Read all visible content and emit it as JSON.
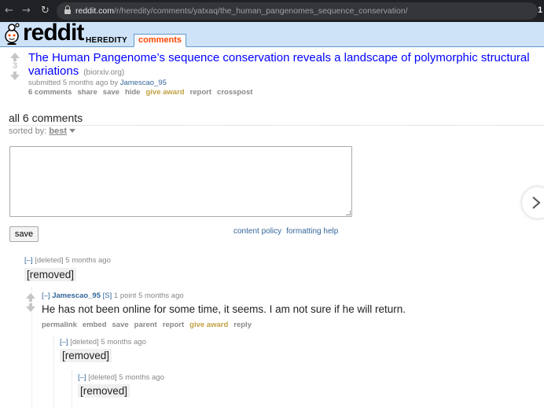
{
  "browser": {
    "back_icon": "arrow-left-icon",
    "forward_icon": "arrow-right-icon",
    "reload_icon": "reload-icon",
    "url_host": "reddit.com",
    "url_path": "/r/heredity/comments/yatxaq/the_human_pangenomes_sequence_conservation/",
    "extension_badge": "1"
  },
  "header": {
    "logo_text": "reddit",
    "subreddit": "HEREDITY",
    "active_tab": "comments"
  },
  "post": {
    "score": "3",
    "title_line1": "The Human Pangenome’s sequence conservation reveals a landscape of polymorphic structural",
    "title_line2": "variations",
    "domain": "(biorxiv.org)",
    "submitted_prefix": "submitted 5 months ago by ",
    "author": "Jamescao_95",
    "buttons": [
      "6 comments",
      "share",
      "save",
      "hide",
      "give award",
      "report",
      "crosspost"
    ]
  },
  "comments_section": {
    "heading": "all 6 comments",
    "sorted_label": "sorted by: ",
    "sort_value": "best",
    "save_label": "save",
    "content_policy": "content policy",
    "formatting_help": "formatting help"
  },
  "comments": [
    {
      "toggle": "[–]",
      "author": "[deleted]",
      "meta": "5 months ago",
      "body": "[removed]"
    },
    {
      "toggle": "[–]",
      "author": "Jamescao_95",
      "op": "[S]",
      "meta": "1 point 5 months ago",
      "body": "He has not been online for some time, it seems. I am not sure if he will return.",
      "buttons": [
        "permalink",
        "embed",
        "save",
        "parent",
        "report",
        "give award",
        "reply"
      ]
    },
    {
      "toggle": "[–]",
      "author": "[deleted]",
      "meta": "5 months ago",
      "body": "[removed]"
    },
    {
      "toggle": "[–]",
      "author": "[deleted]",
      "meta": "5 months ago",
      "body": "[removed]"
    }
  ],
  "colors": {
    "link_blue": "#0000ff",
    "header_bg": "#cee3f8",
    "tab_orange": "#ff4500",
    "award_gold": "#c0a040"
  }
}
